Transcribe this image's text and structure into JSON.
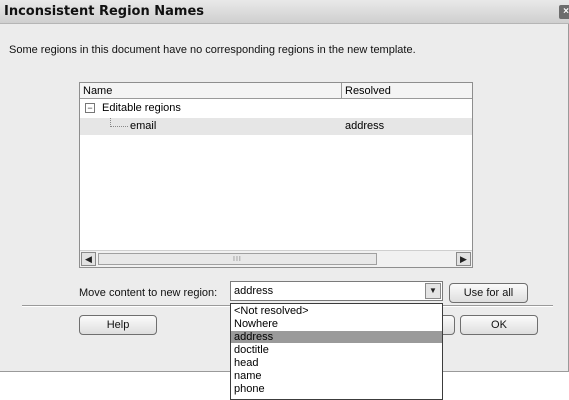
{
  "dialog": {
    "title": "Inconsistent Region Names",
    "close_glyph": "×",
    "message": "Some regions in this document have no corresponding regions in the new template."
  },
  "tree": {
    "headers": {
      "name": "Name",
      "resolved": "Resolved"
    },
    "expander_glyph": "−",
    "group_label": "Editable regions",
    "rows": [
      {
        "name": "email",
        "resolved": "address"
      }
    ],
    "scroll_left_glyph": "◀",
    "scroll_right_glyph": "▶",
    "scroll_grip": "III"
  },
  "move": {
    "label": "Move content to new region:",
    "value": "address",
    "arrow_glyph": "▼",
    "use_for_all": "Use for all"
  },
  "dropdown": {
    "options": [
      "<Not resolved>",
      "Nowhere",
      "address",
      "doctitle",
      "head",
      "name",
      "phone"
    ],
    "selected": "address"
  },
  "buttons": {
    "help": "Help",
    "ok": "OK"
  },
  "icons": {
    "close": "close-icon",
    "expander": "collapse-icon",
    "dropdown": "chevron-down-icon"
  }
}
